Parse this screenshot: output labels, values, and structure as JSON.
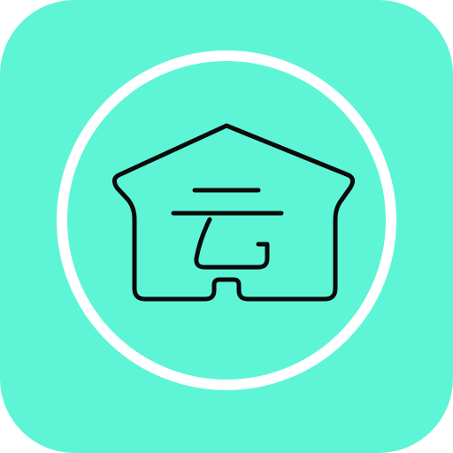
{
  "app": {
    "icon_name": "house-cloud-logo-icon",
    "logo_glyph": "云"
  },
  "colors": {
    "background": "#5ef5d6",
    "ring": "#ffffff",
    "stroke": "#0b0b0b"
  }
}
